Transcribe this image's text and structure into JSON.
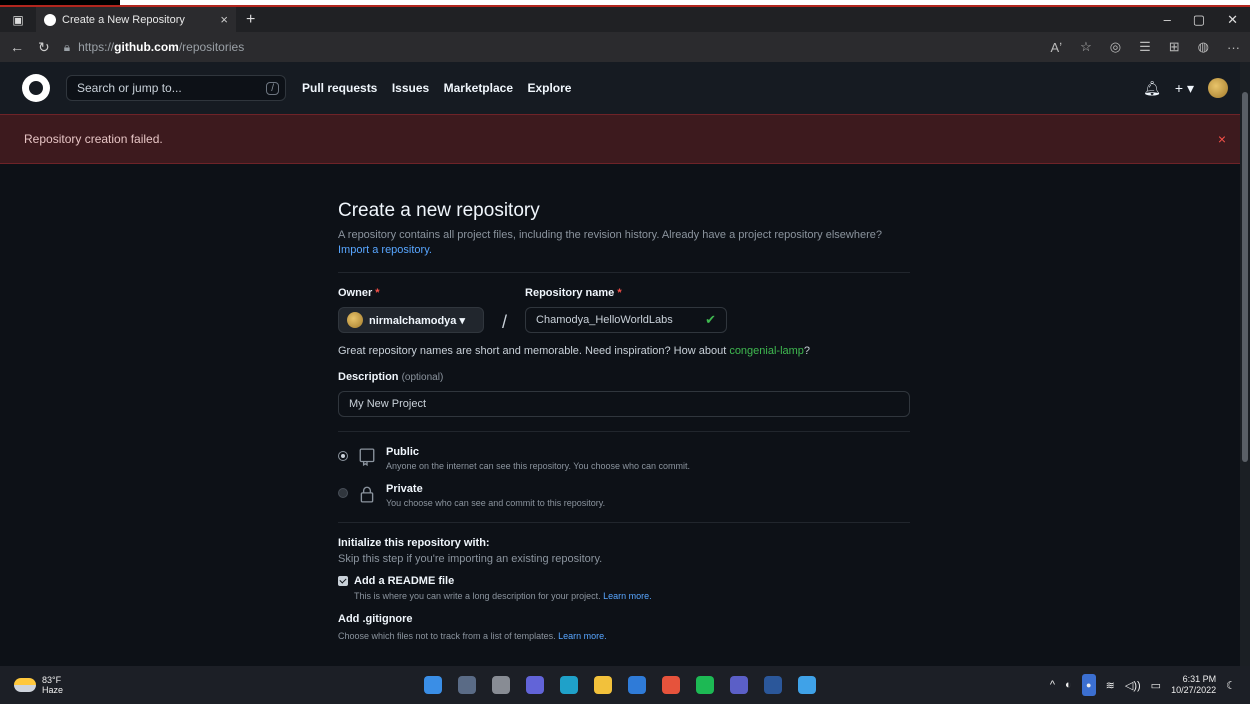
{
  "browser": {
    "tab_title": "Create a New Repository",
    "tab_close": "×",
    "new_tab": "+",
    "url_prefix": "https://",
    "url_domain": "github.com",
    "url_path": "/repositories",
    "window_minimize": "–",
    "window_restore": "▢",
    "window_close": "✕"
  },
  "header": {
    "search_placeholder": "Search or jump to...",
    "search_shortcut": "/",
    "nav": [
      "Pull requests",
      "Issues",
      "Marketplace",
      "Explore"
    ],
    "plus": "+ ▾"
  },
  "flash": {
    "message": "Repository creation failed.",
    "close": "×"
  },
  "form": {
    "title": "Create a new repository",
    "lead": "A repository contains all project files, including the revision history. Already have a project repository elsewhere?",
    "import_link": "Import a repository.",
    "owner_label": "Owner",
    "required_mark": "*",
    "owner_value": "nirmalchamodya ▾",
    "separator": "/",
    "repo_label": "Repository name",
    "repo_value": "Chamodya_HelloWorldLabs",
    "repo_valid": "✔",
    "hint_text": "Great repository names are short and memorable. Need inspiration? How about ",
    "hint_suggestion": "congenial-lamp",
    "hint_end": "?",
    "desc_label": "Description",
    "desc_optional": "(optional)",
    "desc_value": "My New Project",
    "public_title": "Public",
    "public_desc": "Anyone on the internet can see this repository. You choose who can commit.",
    "private_title": "Private",
    "private_desc": "You choose who can see and commit to this repository.",
    "init_title": "Initialize this repository with:",
    "init_sub": "Skip this step if you're importing an existing repository.",
    "readme_label": "Add a README file",
    "readme_desc": "This is where you can write a long description for your project.",
    "learn_more": "Learn more.",
    "gitignore_title": "Add .gitignore",
    "gitignore_desc": "Choose which files not to track from a list of templates."
  },
  "taskbar": {
    "temp": "83°F",
    "weather": "Haze",
    "time": "6:31 PM",
    "date": "10/27/2022",
    "icons": [
      {
        "name": "windows-start-icon",
        "color": "#3a8ee6"
      },
      {
        "name": "search-icon",
        "color": "#5a6b86"
      },
      {
        "name": "task-view-icon",
        "color": "#888c94"
      },
      {
        "name": "chat-icon",
        "color": "#6264d8"
      },
      {
        "name": "edge-icon",
        "color": "#1fa1c9"
      },
      {
        "name": "file-explorer-icon",
        "color": "#f2c13b"
      },
      {
        "name": "mail-icon",
        "color": "#2f7bd8"
      },
      {
        "name": "chrome-icon",
        "color": "#e6533c"
      },
      {
        "name": "spotify-icon",
        "color": "#1db954"
      },
      {
        "name": "teams-icon",
        "color": "#5b5fc7"
      },
      {
        "name": "word-icon",
        "color": "#2b579a"
      },
      {
        "name": "photos-icon",
        "color": "#3fa2e8"
      }
    ]
  }
}
